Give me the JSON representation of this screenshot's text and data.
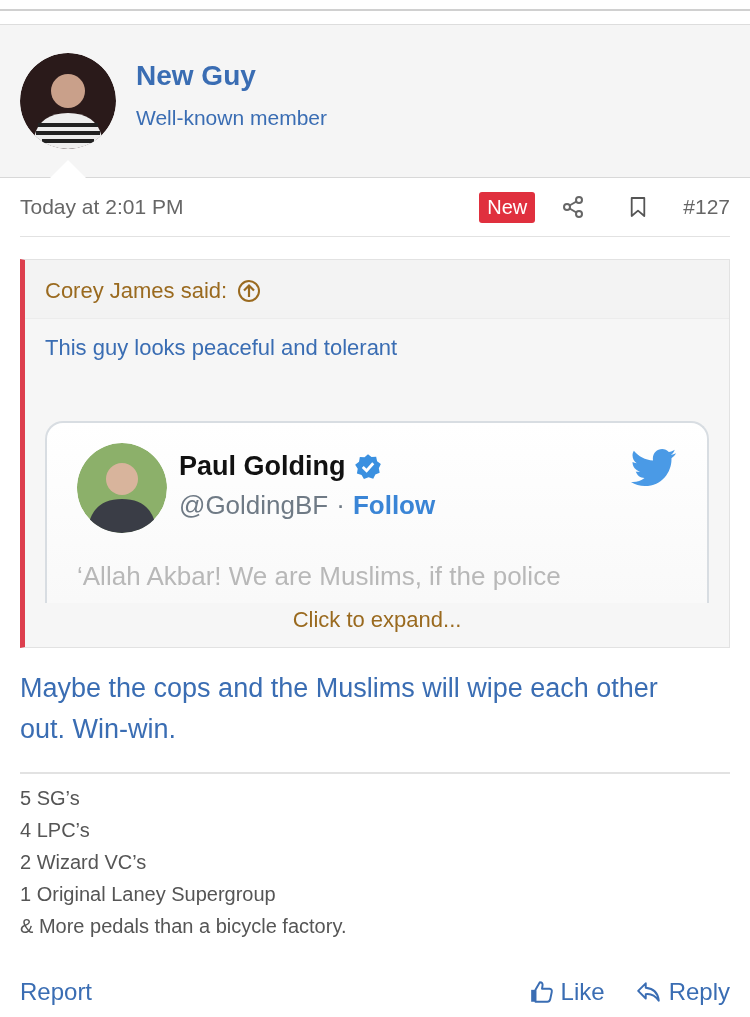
{
  "author": {
    "name": "New Guy",
    "title": "Well-known member"
  },
  "post_meta": {
    "date": "Today at 2:01 PM",
    "badge": "New",
    "number": "#127"
  },
  "quote": {
    "attribution": "Corey James said:",
    "text": "This guy looks peaceful and tolerant",
    "tweet": {
      "name": "Paul Golding",
      "verified": true,
      "handle": "@GoldingBF",
      "separator": "·",
      "follow": "Follow",
      "text": "‘Allah Akbar! We are Muslims, if the police"
    },
    "expand": "Click to expand..."
  },
  "body": "Maybe the cops and the Muslims will wipe each other out. Win-win.",
  "signature": [
    "5 SG’s",
    "4 LPC’s",
    "2 Wizard VC’s",
    "1 Original Laney Supergroup",
    "& More pedals than a bicycle factory."
  ],
  "actions": {
    "report": "Report",
    "like": "Like",
    "reply": "Reply"
  }
}
